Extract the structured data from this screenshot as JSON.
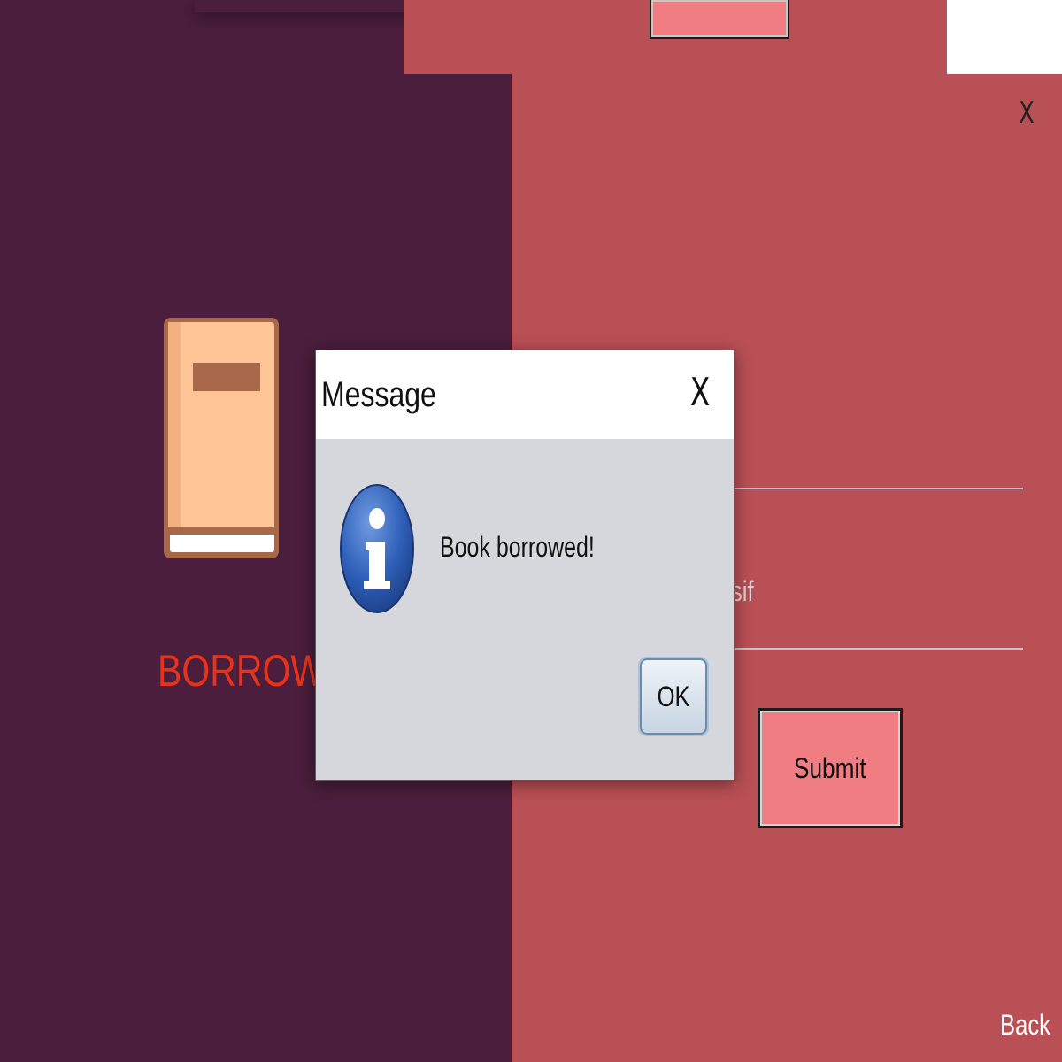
{
  "borrow_window": {
    "close_label": "X",
    "action_label": "BORROW",
    "field_partial_text": "sif",
    "submit_label": "Submit",
    "back_label": "Back"
  },
  "message_dialog": {
    "title": "Message",
    "close_label": "X",
    "message": "Book borrowed!",
    "ok_label": "OK"
  },
  "icons": {
    "book": "book-icon",
    "info": "info-icon"
  },
  "colors": {
    "left_panel": "#4a1e3c",
    "right_panel": "#b95055",
    "button": "#f07d82",
    "borrow_text": "#e8331b",
    "dialog_bg": "#d5d7dd"
  }
}
